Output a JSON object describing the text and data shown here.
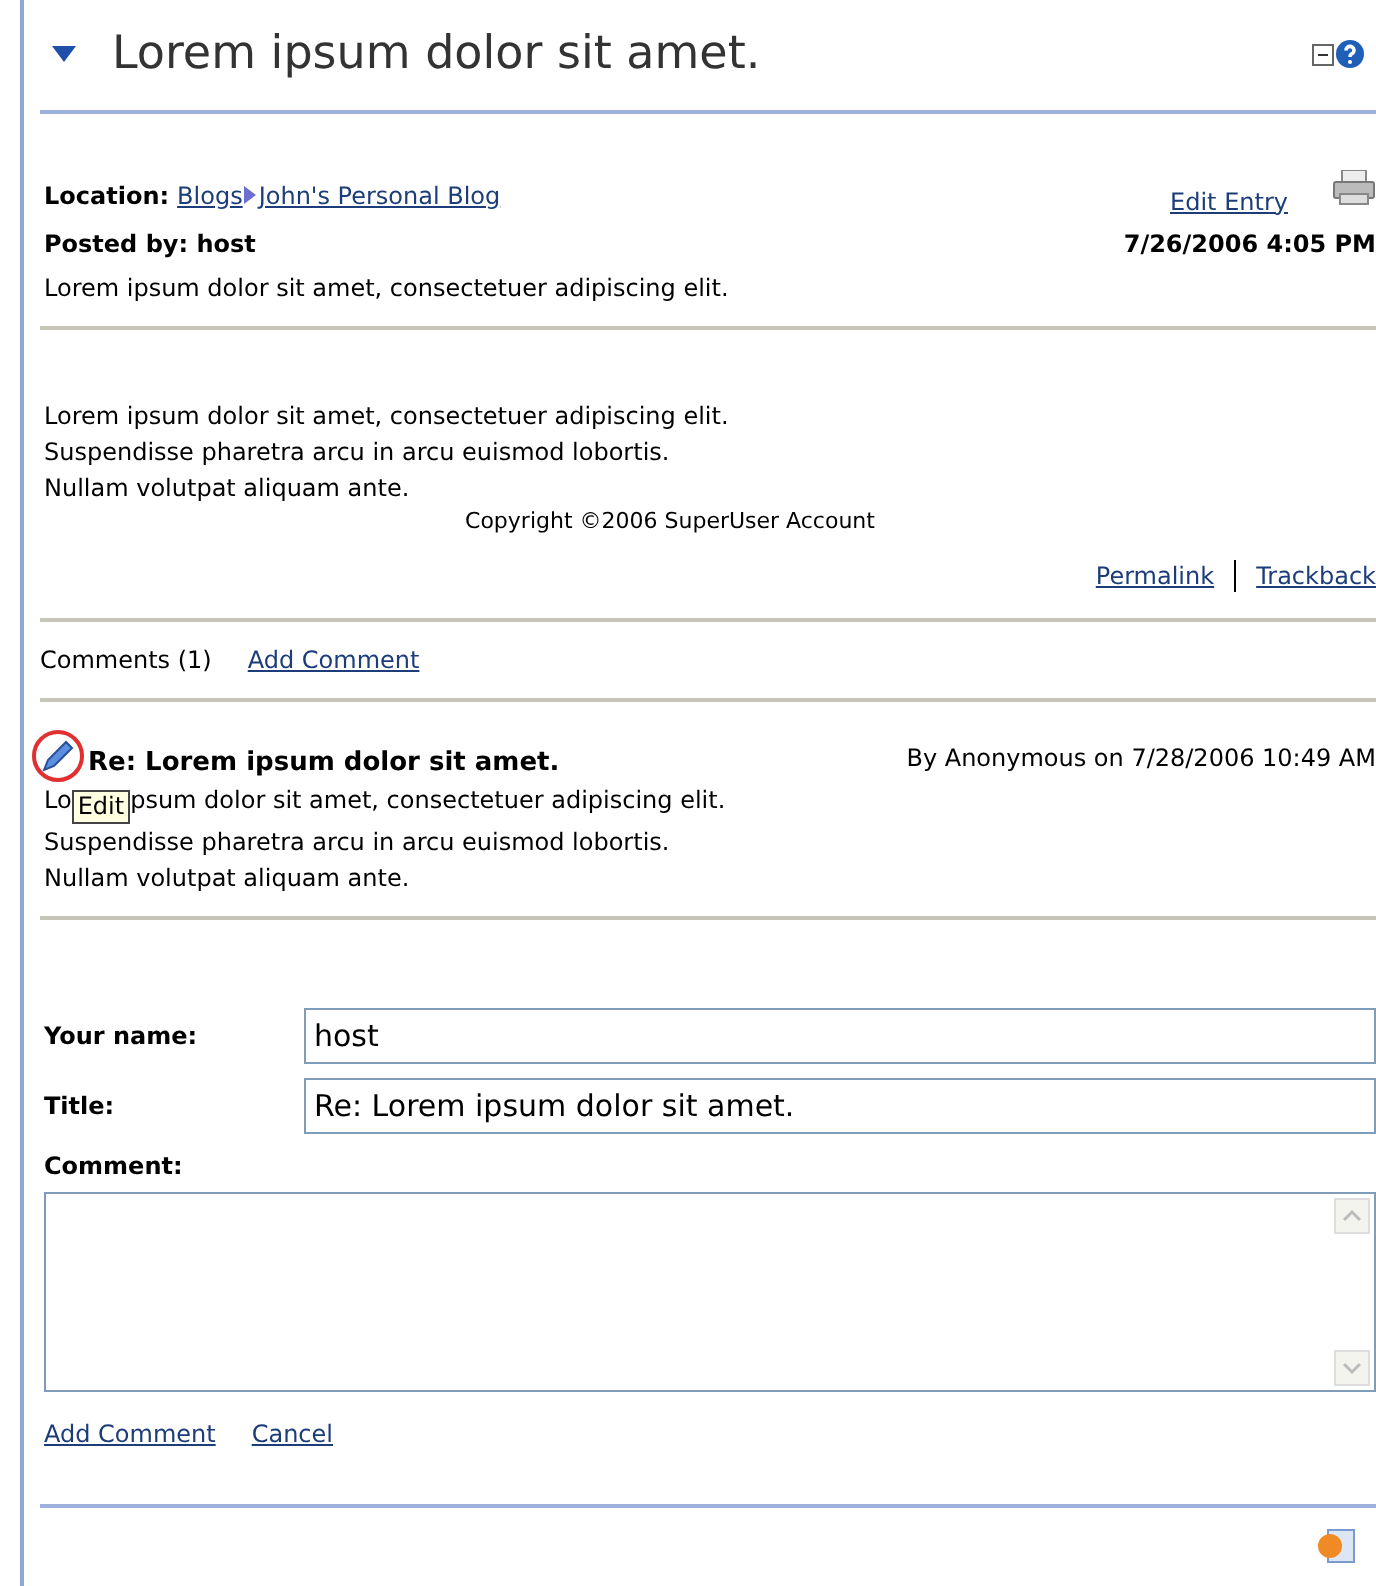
{
  "header": {
    "title": "Lorem ipsum dolor sit amet.",
    "expanded": true
  },
  "entry": {
    "location_label": "Location:",
    "breadcrumb": [
      "Blogs",
      "John's Personal Blog"
    ],
    "edit_link": "Edit Entry",
    "posted_by": "Posted by: host",
    "date": "7/26/2006 4:05 PM",
    "summary": "Lorem ipsum dolor sit amet, consectetuer adipiscing elit.",
    "body": [
      "Lorem ipsum dolor sit amet, consectetuer adipiscing elit.",
      "Suspendisse pharetra arcu in arcu euismod lobortis.",
      "Nullam volutpat aliquam ante."
    ],
    "copyright": "Copyright ©2006 SuperUser Account",
    "links": [
      "Permalink",
      "Trackback"
    ]
  },
  "comments_bar": {
    "count": "Comments (1)",
    "add_link": "Add Comment"
  },
  "comments": [
    {
      "title": "Re: Lorem ipsum dolor sit amet.",
      "byline": "By Anonymous on 7/28/2006 10:49 AM",
      "first_line": [
        "Lo",
        "psum dolor sit amet, consectetuer adipiscing elit."
      ],
      "tooltip": "Edit",
      "body": [
        "Suspendisse pharetra arcu in arcu euismod lobortis.",
        "Nullam volutpat aliquam ante."
      ]
    }
  ],
  "form": {
    "fields": [
      {
        "label": "Your name:",
        "value": "host"
      },
      {
        "label": "Title:",
        "value": "Re: Lorem ipsum dolor sit amet."
      }
    ],
    "comment_label": "Comment:",
    "buttons": [
      "Add Comment",
      "Cancel"
    ]
  }
}
